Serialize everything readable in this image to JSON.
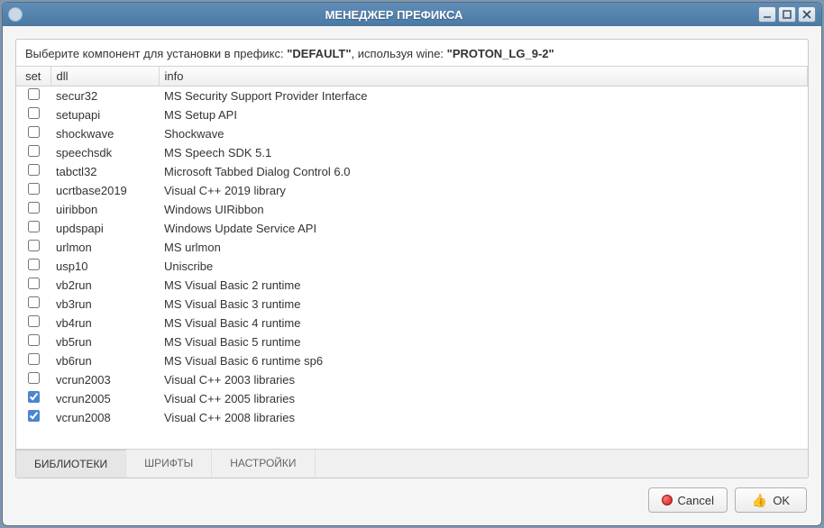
{
  "window": {
    "title": "МЕНЕДЖЕР ПРЕФИКСА"
  },
  "instruction": {
    "prefix_text": "Выберите компонент для установки в префикс: ",
    "prefix_value": "\"DEFAULT\"",
    "mid_text": ", используя wine: ",
    "wine_value": "\"PROTON_LG_9-2\""
  },
  "columns": {
    "set": "set",
    "dll": "dll",
    "info": "info"
  },
  "rows": [
    {
      "checked": false,
      "dll": "secur32",
      "info": "MS Security Support Provider Interface"
    },
    {
      "checked": false,
      "dll": "setupapi",
      "info": "MS Setup API"
    },
    {
      "checked": false,
      "dll": "shockwave",
      "info": "Shockwave"
    },
    {
      "checked": false,
      "dll": "speechsdk",
      "info": "MS Speech SDK 5.1"
    },
    {
      "checked": false,
      "dll": "tabctl32",
      "info": "Microsoft Tabbed Dialog Control 6.0"
    },
    {
      "checked": false,
      "dll": "ucrtbase2019",
      "info": "Visual C++ 2019 library"
    },
    {
      "checked": false,
      "dll": "uiribbon",
      "info": "Windows UIRibbon"
    },
    {
      "checked": false,
      "dll": "updspapi",
      "info": "Windows Update Service API"
    },
    {
      "checked": false,
      "dll": "urlmon",
      "info": "MS urlmon"
    },
    {
      "checked": false,
      "dll": "usp10",
      "info": "Uniscribe"
    },
    {
      "checked": false,
      "dll": "vb2run",
      "info": "MS Visual Basic 2 runtime"
    },
    {
      "checked": false,
      "dll": "vb3run",
      "info": "MS Visual Basic 3 runtime"
    },
    {
      "checked": false,
      "dll": "vb4run",
      "info": "MS Visual Basic 4 runtime"
    },
    {
      "checked": false,
      "dll": "vb5run",
      "info": "MS Visual Basic 5 runtime"
    },
    {
      "checked": false,
      "dll": "vb6run",
      "info": "MS Visual Basic 6 runtime sp6"
    },
    {
      "checked": false,
      "dll": "vcrun2003",
      "info": "Visual C++ 2003 libraries"
    },
    {
      "checked": true,
      "dll": "vcrun2005",
      "info": "Visual C++ 2005 libraries"
    },
    {
      "checked": true,
      "dll": "vcrun2008",
      "info": "Visual C++ 2008 libraries"
    }
  ],
  "tabs": {
    "libraries": "БИБЛИОТЕКИ",
    "fonts": "ШРИФТЫ",
    "settings": "НАСТРОЙКИ",
    "active": "libraries"
  },
  "buttons": {
    "cancel": "Cancel",
    "ok": "OK"
  }
}
